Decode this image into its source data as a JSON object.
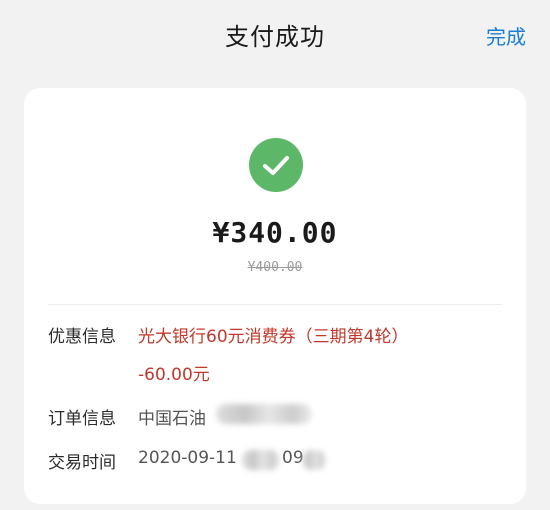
{
  "header": {
    "title": "支付成功",
    "done_label": "完成"
  },
  "payment": {
    "amount": "¥340.00",
    "original_amount": "¥400.00"
  },
  "details": {
    "discount_label": "优惠信息",
    "discount_value": "光大银行60元消费券（三期第4轮）",
    "discount_amount": "-60.00元",
    "order_label": "订单信息",
    "order_value": "中国石油",
    "time_label": "交易时间",
    "time_value_prefix": "2020-09-11",
    "time_value_mid": "09"
  },
  "colors": {
    "accent": "#1a7fd4",
    "success": "#5cb768",
    "discount": "#c0392b"
  }
}
